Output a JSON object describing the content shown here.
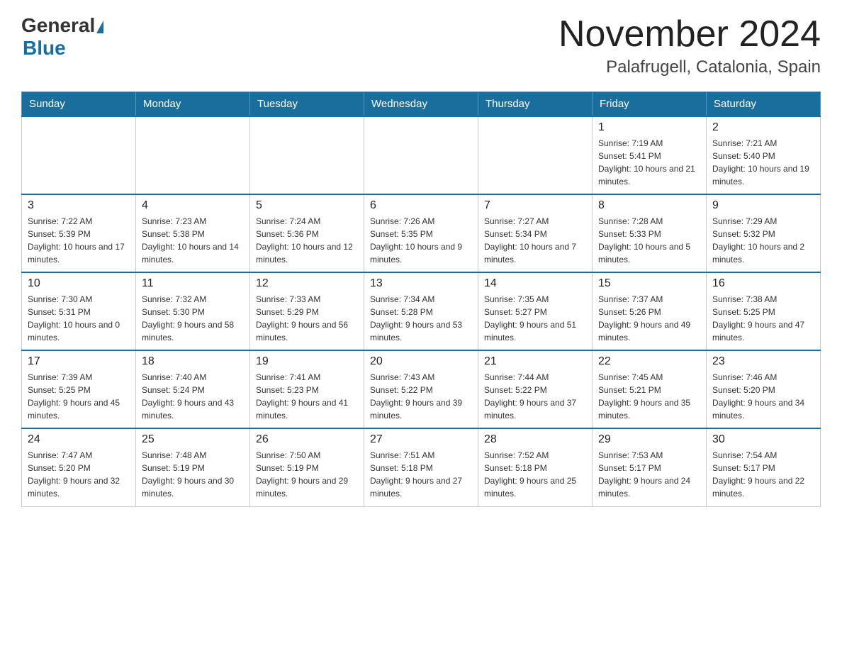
{
  "logo": {
    "general": "General",
    "blue": "Blue"
  },
  "title": "November 2024",
  "location": "Palafrugell, Catalonia, Spain",
  "weekdays": [
    "Sunday",
    "Monday",
    "Tuesday",
    "Wednesday",
    "Thursday",
    "Friday",
    "Saturday"
  ],
  "weeks": [
    [
      {
        "day": "",
        "sunrise": "",
        "sunset": "",
        "daylight": ""
      },
      {
        "day": "",
        "sunrise": "",
        "sunset": "",
        "daylight": ""
      },
      {
        "day": "",
        "sunrise": "",
        "sunset": "",
        "daylight": ""
      },
      {
        "day": "",
        "sunrise": "",
        "sunset": "",
        "daylight": ""
      },
      {
        "day": "",
        "sunrise": "",
        "sunset": "",
        "daylight": ""
      },
      {
        "day": "1",
        "sunrise": "Sunrise: 7:19 AM",
        "sunset": "Sunset: 5:41 PM",
        "daylight": "Daylight: 10 hours and 21 minutes."
      },
      {
        "day": "2",
        "sunrise": "Sunrise: 7:21 AM",
        "sunset": "Sunset: 5:40 PM",
        "daylight": "Daylight: 10 hours and 19 minutes."
      }
    ],
    [
      {
        "day": "3",
        "sunrise": "Sunrise: 7:22 AM",
        "sunset": "Sunset: 5:39 PM",
        "daylight": "Daylight: 10 hours and 17 minutes."
      },
      {
        "day": "4",
        "sunrise": "Sunrise: 7:23 AM",
        "sunset": "Sunset: 5:38 PM",
        "daylight": "Daylight: 10 hours and 14 minutes."
      },
      {
        "day": "5",
        "sunrise": "Sunrise: 7:24 AM",
        "sunset": "Sunset: 5:36 PM",
        "daylight": "Daylight: 10 hours and 12 minutes."
      },
      {
        "day": "6",
        "sunrise": "Sunrise: 7:26 AM",
        "sunset": "Sunset: 5:35 PM",
        "daylight": "Daylight: 10 hours and 9 minutes."
      },
      {
        "day": "7",
        "sunrise": "Sunrise: 7:27 AM",
        "sunset": "Sunset: 5:34 PM",
        "daylight": "Daylight: 10 hours and 7 minutes."
      },
      {
        "day": "8",
        "sunrise": "Sunrise: 7:28 AM",
        "sunset": "Sunset: 5:33 PM",
        "daylight": "Daylight: 10 hours and 5 minutes."
      },
      {
        "day": "9",
        "sunrise": "Sunrise: 7:29 AM",
        "sunset": "Sunset: 5:32 PM",
        "daylight": "Daylight: 10 hours and 2 minutes."
      }
    ],
    [
      {
        "day": "10",
        "sunrise": "Sunrise: 7:30 AM",
        "sunset": "Sunset: 5:31 PM",
        "daylight": "Daylight: 10 hours and 0 minutes."
      },
      {
        "day": "11",
        "sunrise": "Sunrise: 7:32 AM",
        "sunset": "Sunset: 5:30 PM",
        "daylight": "Daylight: 9 hours and 58 minutes."
      },
      {
        "day": "12",
        "sunrise": "Sunrise: 7:33 AM",
        "sunset": "Sunset: 5:29 PM",
        "daylight": "Daylight: 9 hours and 56 minutes."
      },
      {
        "day": "13",
        "sunrise": "Sunrise: 7:34 AM",
        "sunset": "Sunset: 5:28 PM",
        "daylight": "Daylight: 9 hours and 53 minutes."
      },
      {
        "day": "14",
        "sunrise": "Sunrise: 7:35 AM",
        "sunset": "Sunset: 5:27 PM",
        "daylight": "Daylight: 9 hours and 51 minutes."
      },
      {
        "day": "15",
        "sunrise": "Sunrise: 7:37 AM",
        "sunset": "Sunset: 5:26 PM",
        "daylight": "Daylight: 9 hours and 49 minutes."
      },
      {
        "day": "16",
        "sunrise": "Sunrise: 7:38 AM",
        "sunset": "Sunset: 5:25 PM",
        "daylight": "Daylight: 9 hours and 47 minutes."
      }
    ],
    [
      {
        "day": "17",
        "sunrise": "Sunrise: 7:39 AM",
        "sunset": "Sunset: 5:25 PM",
        "daylight": "Daylight: 9 hours and 45 minutes."
      },
      {
        "day": "18",
        "sunrise": "Sunrise: 7:40 AM",
        "sunset": "Sunset: 5:24 PM",
        "daylight": "Daylight: 9 hours and 43 minutes."
      },
      {
        "day": "19",
        "sunrise": "Sunrise: 7:41 AM",
        "sunset": "Sunset: 5:23 PM",
        "daylight": "Daylight: 9 hours and 41 minutes."
      },
      {
        "day": "20",
        "sunrise": "Sunrise: 7:43 AM",
        "sunset": "Sunset: 5:22 PM",
        "daylight": "Daylight: 9 hours and 39 minutes."
      },
      {
        "day": "21",
        "sunrise": "Sunrise: 7:44 AM",
        "sunset": "Sunset: 5:22 PM",
        "daylight": "Daylight: 9 hours and 37 minutes."
      },
      {
        "day": "22",
        "sunrise": "Sunrise: 7:45 AM",
        "sunset": "Sunset: 5:21 PM",
        "daylight": "Daylight: 9 hours and 35 minutes."
      },
      {
        "day": "23",
        "sunrise": "Sunrise: 7:46 AM",
        "sunset": "Sunset: 5:20 PM",
        "daylight": "Daylight: 9 hours and 34 minutes."
      }
    ],
    [
      {
        "day": "24",
        "sunrise": "Sunrise: 7:47 AM",
        "sunset": "Sunset: 5:20 PM",
        "daylight": "Daylight: 9 hours and 32 minutes."
      },
      {
        "day": "25",
        "sunrise": "Sunrise: 7:48 AM",
        "sunset": "Sunset: 5:19 PM",
        "daylight": "Daylight: 9 hours and 30 minutes."
      },
      {
        "day": "26",
        "sunrise": "Sunrise: 7:50 AM",
        "sunset": "Sunset: 5:19 PM",
        "daylight": "Daylight: 9 hours and 29 minutes."
      },
      {
        "day": "27",
        "sunrise": "Sunrise: 7:51 AM",
        "sunset": "Sunset: 5:18 PM",
        "daylight": "Daylight: 9 hours and 27 minutes."
      },
      {
        "day": "28",
        "sunrise": "Sunrise: 7:52 AM",
        "sunset": "Sunset: 5:18 PM",
        "daylight": "Daylight: 9 hours and 25 minutes."
      },
      {
        "day": "29",
        "sunrise": "Sunrise: 7:53 AM",
        "sunset": "Sunset: 5:17 PM",
        "daylight": "Daylight: 9 hours and 24 minutes."
      },
      {
        "day": "30",
        "sunrise": "Sunrise: 7:54 AM",
        "sunset": "Sunset: 5:17 PM",
        "daylight": "Daylight: 9 hours and 22 minutes."
      }
    ]
  ]
}
